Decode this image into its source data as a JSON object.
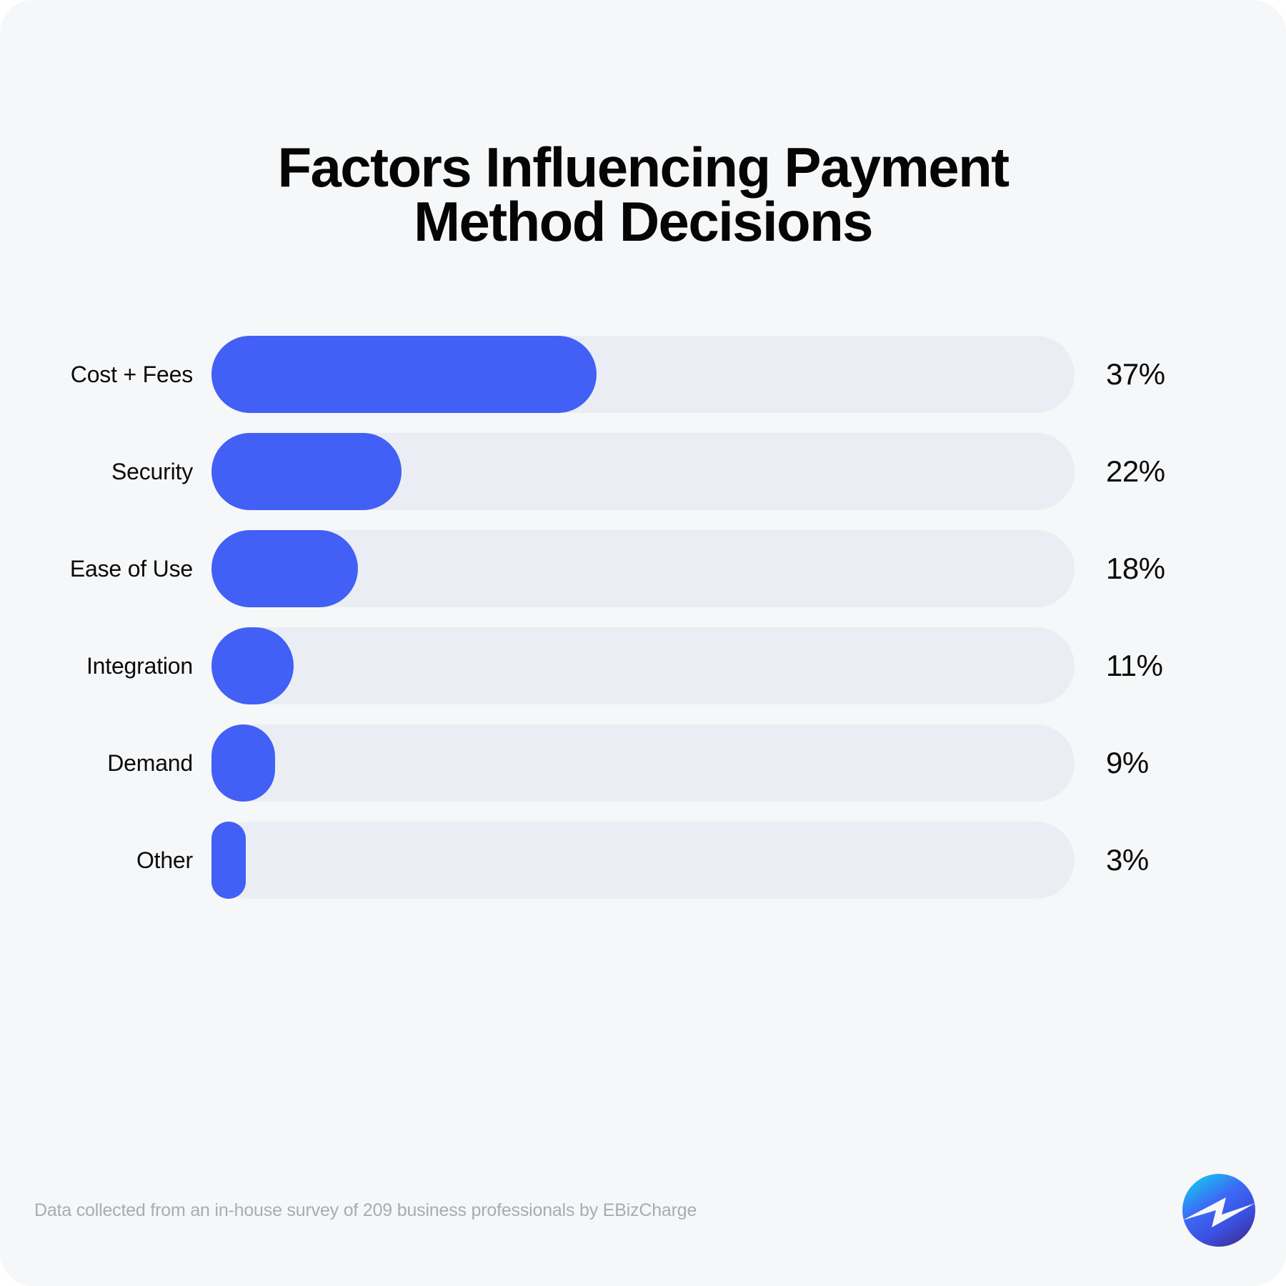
{
  "card": {
    "background_color": "#f6f7f8"
  },
  "title": {
    "line1": "Factors Influencing Payment",
    "line2": "Method Decisions",
    "full": "Factors Influencing Payment Method Decisions"
  },
  "footer": {
    "note": "Data collected from an in-house survey of 209 business professionals by EBizCharge",
    "logo_name": "ebizcharge-logo"
  },
  "colors": {
    "bar_fill": "#4260f5",
    "bar_track": "#eaeef4",
    "text": "#0b0b0b",
    "footer_text": "#a7acb4",
    "logo_cyan": "#16c8f0",
    "logo_blue": "#3b5cf5",
    "logo_purple": "#3b2f93"
  },
  "chart_data": {
    "type": "bar",
    "orientation": "horizontal",
    "title": "Factors Influencing Payment Method Decisions",
    "xlabel": "",
    "ylabel": "",
    "xlim": [
      0,
      43
    ],
    "grid": false,
    "legend": "none",
    "value_suffix": "%",
    "categories": [
      "Cost + Fees",
      "Security",
      "Ease of Use",
      "Integration",
      "Demand",
      "Other"
    ],
    "values": [
      37,
      22,
      18,
      11,
      9,
      3
    ],
    "labels": [
      "37%",
      "22%",
      "18%",
      "11%",
      "9%",
      "3%"
    ],
    "bars": [
      {
        "category": "Cost + Fees",
        "value": 37,
        "label": "37%",
        "bar_pct": 44.6
      },
      {
        "category": "Security",
        "value": 22,
        "label": "22%",
        "bar_pct": 22.0
      },
      {
        "category": "Ease of Use",
        "value": 18,
        "label": "18%",
        "bar_pct": 17.0
      },
      {
        "category": "Integration",
        "value": 11,
        "label": "11%",
        "bar_pct": 9.5
      },
      {
        "category": "Demand",
        "value": 9,
        "label": "9%",
        "bar_pct": 7.4
      },
      {
        "category": "Other",
        "value": 3,
        "label": "3%",
        "bar_pct": 4.0
      }
    ],
    "source_note": "Data collected from an in-house survey of 209 business professionals by EBizCharge"
  }
}
